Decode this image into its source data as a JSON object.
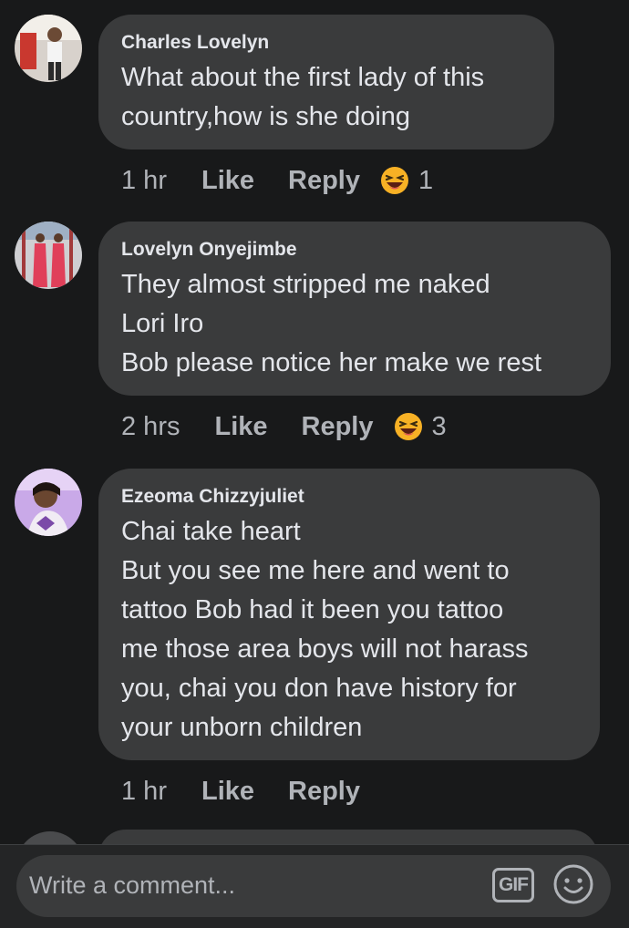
{
  "comments": [
    {
      "author": "Charles Lovelyn",
      "text": "What about the first lady of this\ncountry,how is she doing",
      "time": "1 hr",
      "like_label": "Like",
      "reply_label": "Reply",
      "reaction_icon": "laughing-emoji-icon",
      "reaction_count": "1"
    },
    {
      "author": "Lovelyn Onyejimbe",
      "text": "They almost stripped me naked\nLori Iro\nBob please notice her make we rest",
      "time": "2 hrs",
      "like_label": "Like",
      "reply_label": "Reply",
      "reaction_icon": "laughing-emoji-icon",
      "reaction_count": "3"
    },
    {
      "author": "Ezeoma Chizzyjuliet",
      "text": "Chai take heart\nBut you see me here and went to\ntattoo Bob had it been you tattoo\nme those area boys will not harass\nyou, chai you don have history for\nyour unborn children",
      "time": "1 hr",
      "like_label": "Like",
      "reply_label": "Reply"
    }
  ],
  "composer": {
    "placeholder": "Write a comment...",
    "gif_label": "GIF",
    "emoji_icon": "smiley-icon"
  },
  "colors": {
    "background": "#18191a",
    "bubble": "#3a3b3c",
    "text_primary": "#e4e6eb",
    "text_secondary": "#b0b3b8",
    "reaction_yellow": "#f7b125"
  }
}
